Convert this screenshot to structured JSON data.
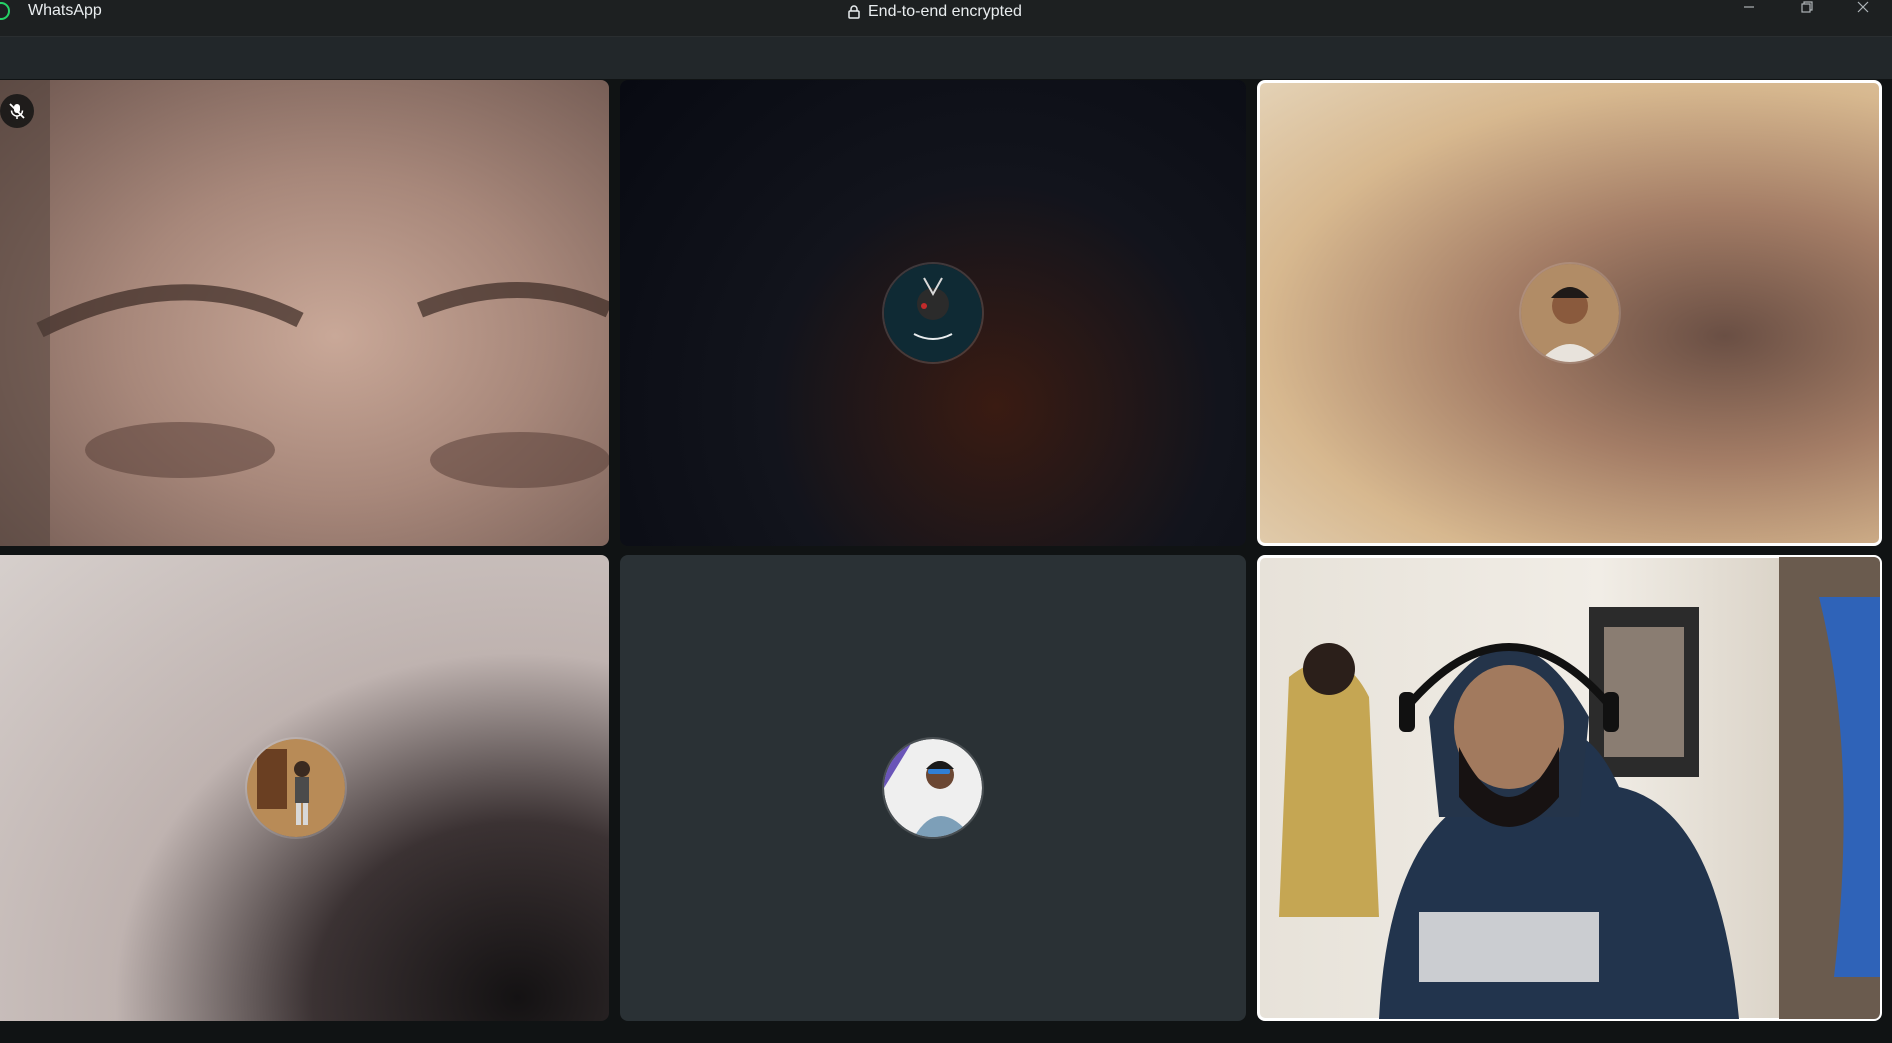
{
  "window": {
    "app_name": "WhatsApp",
    "encryption_label": "End-to-end encrypted",
    "controls": [
      "minimize-icon",
      "restore-icon",
      "close-icon"
    ]
  },
  "participants": [
    {
      "kind": "video",
      "muted": true,
      "selected": false
    },
    {
      "kind": "avatar",
      "muted": false,
      "selected": false
    },
    {
      "kind": "avatar",
      "muted": false,
      "selected": true
    },
    {
      "kind": "avatar",
      "muted": false,
      "selected": false
    },
    {
      "kind": "avatar",
      "muted": false,
      "selected": false
    },
    {
      "kind": "video",
      "muted": false,
      "selected": true
    }
  ],
  "colors": {
    "brand": "#25d366",
    "background": "#1f2324",
    "tile_dark": "#2a3034",
    "selected_border": "#ffffff"
  }
}
